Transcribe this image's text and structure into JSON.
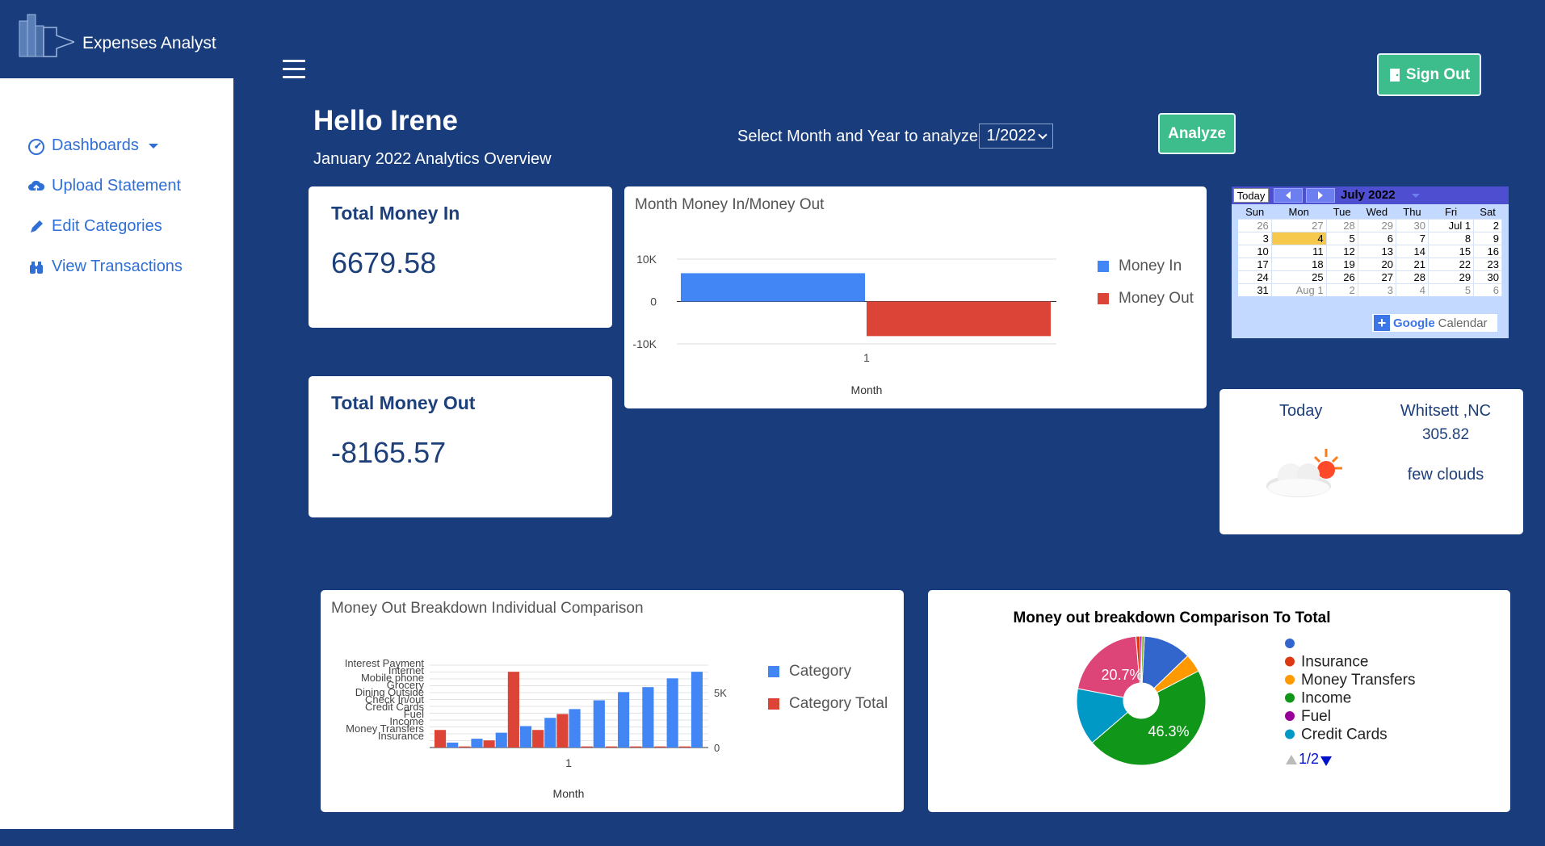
{
  "app": {
    "name": "Expenses Analyst"
  },
  "sidebar": {
    "items": [
      {
        "label": "Dashboards",
        "icon": "dashboard-icon"
      },
      {
        "label": "Upload Statement",
        "icon": "cloud-upload-icon"
      },
      {
        "label": "Edit Categories",
        "icon": "pencil-icon"
      },
      {
        "label": "View Transactions",
        "icon": "binoculars-icon"
      }
    ]
  },
  "header": {
    "sign_out_label": "Sign Out",
    "greeting": "Hello Irene",
    "subtitle": "January 2022 Analytics Overview",
    "month_prompt": "Select Month and Year to analyze",
    "selected_month": "1/2022",
    "analyze_label": "Analyze"
  },
  "stats": {
    "money_in": {
      "title": "Total Money In",
      "value": "6679.58"
    },
    "money_out": {
      "title": "Total Money Out",
      "value": "-8165.57"
    }
  },
  "colors": {
    "blue": "#4285f4",
    "red": "#db4437",
    "orange": "#ff9900",
    "green": "#109618",
    "purple": "#990099",
    "teal": "#0099c6",
    "pink": "#dd4477",
    "accent": "#3dbd8c",
    "navy": "#193d7c"
  },
  "calendar": {
    "today_label": "Today",
    "month_label": "July 2022",
    "weekdays": [
      "Sun",
      "Mon",
      "Tue",
      "Wed",
      "Thu",
      "Fri",
      "Sat"
    ],
    "footer_label": "Calendar",
    "footer_brand": "Google"
  },
  "weather": {
    "today_label": "Today",
    "location": "Whitsett ,NC",
    "temperature": "305.82",
    "description": "few clouds"
  },
  "chart_data": [
    {
      "type": "bar",
      "title": "Month Money In/Money Out",
      "xlabel": "Month",
      "ylabel": "",
      "categories": [
        "1"
      ],
      "series": [
        {
          "name": "Money In",
          "values": [
            6679.58
          ]
        },
        {
          "name": "Money Out",
          "values": [
            -8165.57
          ]
        }
      ],
      "ylim": [
        -10000,
        10000
      ],
      "yticks": [
        "10K",
        "0",
        "-10K"
      ],
      "legend": "right"
    },
    {
      "type": "bar",
      "title": "Money Out Breakdown Individual Comparison",
      "xlabel": "Month",
      "categories": [
        "1"
      ],
      "left_axis_labels": [
        "Interest Payment",
        "Internet",
        "Mobile phone",
        "Grocery",
        "Dining Outside",
        "Check In/out",
        "Credit Cards",
        "Fuel",
        "Income",
        "Money Transfers",
        "Insurance"
      ],
      "right_ticks": [
        "5K",
        "0"
      ],
      "series": [
        {
          "name": "Category",
          "values": [
            450,
            800,
            1350,
            1950,
            2700,
            3500,
            4300,
            5050,
            5500,
            6300,
            6900
          ]
        },
        {
          "name": "Category Total",
          "values": [
            1600,
            100,
            650,
            6900,
            1600,
            3050,
            100,
            100,
            100,
            100,
            100
          ]
        }
      ],
      "legend": "right"
    },
    {
      "type": "pie",
      "title": "Money out breakdown Comparison To Total",
      "legend_entries": [
        "",
        "Insurance",
        "Money Transfers",
        "Income",
        "Fuel",
        "Credit Cards"
      ],
      "legend_pager": "1/2",
      "slices": [
        {
          "label": "",
          "percent": 12.0,
          "color": "#3366cc"
        },
        {
          "label": "Money Transfers",
          "percent": 4.6,
          "color": "#ff9900"
        },
        {
          "label": "Income",
          "percent": 46.3,
          "color": "#109618"
        },
        {
          "label": "Credit Cards",
          "percent": 14.3,
          "color": "#0099c6"
        },
        {
          "label": "",
          "percent": 20.7,
          "color": "#dd4477"
        },
        {
          "label": "Insurance",
          "percent": 1.0,
          "color": "#dc3912"
        },
        {
          "label": "Fuel",
          "percent": 0.5,
          "color": "#990099"
        },
        {
          "label": "",
          "percent": 0.6,
          "color": "#66aa00"
        }
      ],
      "labels_shown": [
        "20.7%",
        "46.3%"
      ]
    }
  ]
}
